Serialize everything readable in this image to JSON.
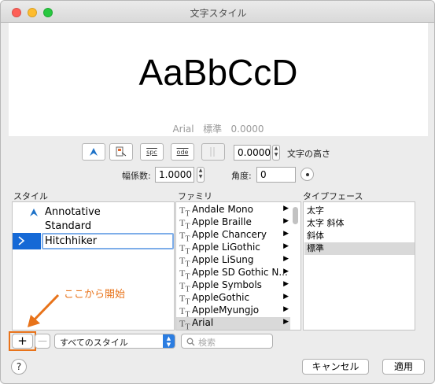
{
  "window": {
    "title": "文字スタイル"
  },
  "preview": {
    "sample_text": "AaBbCcD",
    "font_name": "Arial",
    "font_style": "標準",
    "height": "0.0000"
  },
  "toolbar": {
    "tool_spc": "spc",
    "tool_ode": "ode"
  },
  "fields": {
    "height_value": "0.0000",
    "height_label": "文字の高さ",
    "width_label": "幅係数:",
    "width_value": "1.0000",
    "angle_label": "角度:",
    "angle_value": "0"
  },
  "styles": {
    "header": "スタイル",
    "items": [
      {
        "label": "Annotative"
      },
      {
        "label": "Standard"
      },
      {
        "label": "Hitchhiker"
      }
    ]
  },
  "family": {
    "header": "ファミリ",
    "items": [
      {
        "label": "Andale Mono"
      },
      {
        "label": "Apple Braille"
      },
      {
        "label": "Apple Chancery"
      },
      {
        "label": "Apple LiGothic"
      },
      {
        "label": "Apple LiSung"
      },
      {
        "label": "Apple SD Gothic N..."
      },
      {
        "label": "Apple Symbols"
      },
      {
        "label": "AppleGothic"
      },
      {
        "label": "AppleMyungjo"
      },
      {
        "label": "Arial"
      }
    ]
  },
  "typeface": {
    "header": "タイプフェース",
    "items": [
      {
        "label": "太字"
      },
      {
        "label": "太字 斜体"
      },
      {
        "label": "斜体"
      },
      {
        "label": "標準"
      }
    ]
  },
  "annotation": {
    "text": "ここから開始",
    "color": "#e8731a"
  },
  "bottom": {
    "add_label": "+",
    "remove_label": "—",
    "filter_value": "すべてのスタイル",
    "search_placeholder": "検索",
    "help_label": "?",
    "cancel_label": "キャンセル",
    "apply_label": "適用"
  },
  "colors": {
    "selection": "#1569d6",
    "accent": "#2b7de1"
  }
}
